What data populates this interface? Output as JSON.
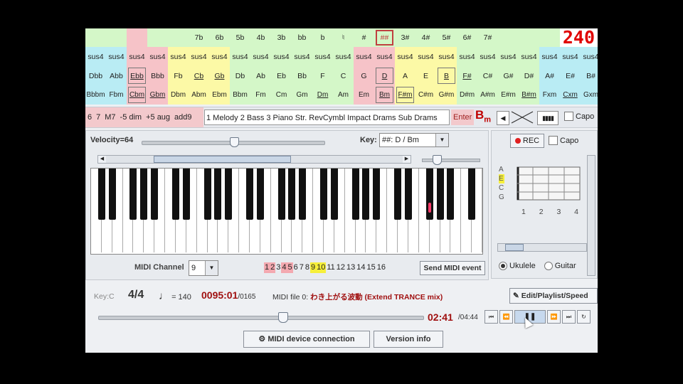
{
  "key_signatures": [
    "",
    "",
    "",
    "",
    "",
    "7b",
    "6b",
    "5b",
    "4b",
    "3b",
    "bb",
    "b",
    "♮",
    "#",
    "##",
    "3#",
    "4#",
    "5#",
    "6#",
    "7#",
    "",
    "",
    "",
    "",
    ""
  ],
  "tempo_display": "240",
  "sus4_row": [
    "sus4",
    "sus4",
    "sus4",
    "sus4",
    "sus4",
    "sus4",
    "sus4",
    "sus4",
    "sus4",
    "sus4",
    "sus4",
    "sus4",
    "sus4",
    "sus4",
    "sus4",
    "sus4",
    "sus4",
    "sus4",
    "sus4",
    "sus4",
    "sus4",
    "sus4",
    "sus4",
    "sus4",
    "sus4"
  ],
  "major_row": [
    "Dbb",
    "Abb",
    "Ebb",
    "Bbb",
    "Fb",
    "Cb",
    "Gb",
    "Db",
    "Ab",
    "Eb",
    "Bb",
    "F",
    "C",
    "G",
    "D",
    "A",
    "E",
    "B",
    "F#",
    "C#",
    "G#",
    "D#",
    "A#",
    "E#",
    "B#"
  ],
  "minor_row": [
    "Bbbm",
    "Fbm",
    "Cbm",
    "Gbm",
    "Dbm",
    "Abm",
    "Ebm",
    "Bbm",
    "Fm",
    "Cm",
    "Gm",
    "Dm",
    "Am",
    "Em",
    "Bm",
    "F#m",
    "C#m",
    "G#m",
    "D#m",
    "A#m",
    "E#m",
    "B#m",
    "Fxm",
    "Cxm",
    "Gxm"
  ],
  "modifiers": [
    "6",
    "7",
    "M7",
    "-5 dim",
    "+5 aug",
    "add9"
  ],
  "drum_field": "1 Melody 2 Bass 3 Piano Str. RevCymbl Impact Drams Sub Drams",
  "enter_label": "Enter",
  "current_chord": {
    "root": "B",
    "quality": "m"
  },
  "capo_label": "Capo",
  "velocity_label": "Velocity=64",
  "velocity": 64,
  "key_label": "Key:",
  "key_value": "##: D / Bm",
  "midi_channel_label": "MIDI Channel",
  "midi_channel_value": "9",
  "channels": [
    "1",
    "2",
    "3",
    "4",
    "5",
    "6",
    "7",
    "8",
    "9",
    "10",
    "11",
    "12",
    "13",
    "14",
    "15",
    "16"
  ],
  "send_midi_label": "Send MIDI event",
  "rec_label": "REC",
  "strings": [
    "A",
    "E",
    "C",
    "G"
  ],
  "frets": [
    "1",
    "2",
    "3",
    "4"
  ],
  "instrument_options": [
    "Ukulele",
    "Guitar"
  ],
  "status": {
    "key_c": "Key:C",
    "time_signature": "4/4",
    "note_symbol": "♩",
    "bpm_text": "= 140",
    "position": "0095:01",
    "position_total": "/0165",
    "midi_file_prefix": "MIDI file 0:",
    "midi_file_title": "わき上がる波動 (Extend TRANCE mix)",
    "edit_label": "Edit/Playlist/Speed",
    "time_current": "02:41",
    "time_total": "/04:44",
    "seek_fraction": 0.567
  },
  "transport_glyphs": {
    "first": "⏮",
    "rew": "⏪",
    "pause": "❚❚",
    "ff": "⏩",
    "last": "⏭",
    "loop": "↻"
  },
  "device_btn_label": "MIDI device connection",
  "version_btn_label": "Version info",
  "colors": {
    "yellow": "#fcf9a6",
    "green": "#d4f7c8",
    "cyan": "#b9ecf4",
    "pink": "#f6c3c8",
    "accent_red": "#e00000"
  }
}
